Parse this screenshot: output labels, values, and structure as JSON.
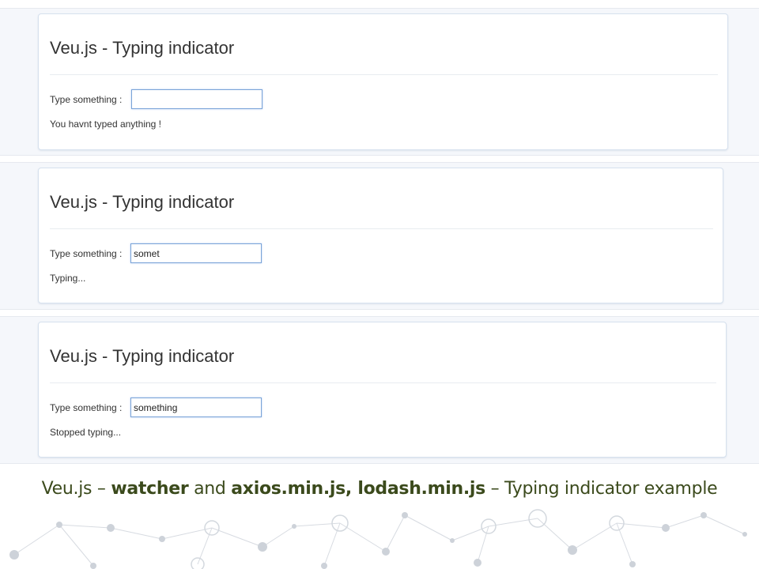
{
  "panels": [
    {
      "title": "Veu.js - Typing indicator",
      "field_label": "Type something :",
      "input_value": "",
      "status": "You havnt typed anything !"
    },
    {
      "title": "Veu.js - Typing indicator",
      "field_label": "Type something :",
      "input_value": "somet",
      "status": "Typing..."
    },
    {
      "title": "Veu.js - Typing indicator",
      "field_label": "Type something :",
      "input_value": "something",
      "status": "Stopped typing..."
    }
  ],
  "caption": {
    "part1": "Veu.js – ",
    "part2": "watcher",
    "part3": " and ",
    "part4": "axios.min.js, lodash.min.js",
    "part5": " – Typing indicator example"
  },
  "colors": {
    "caption": "#3b4a1c",
    "input_border": "#7aa3d8",
    "strip_bg": "#f5f7fb",
    "network": "#c9ced6"
  },
  "icons": {
    "background": "network-dots-decoration"
  }
}
